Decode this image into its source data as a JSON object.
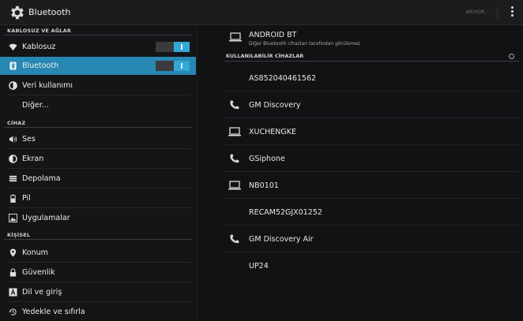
{
  "actionbar": {
    "title": "Bluetooth",
    "status": "ARIYOR...",
    "icon": "settings-gear-icon"
  },
  "sidebar": {
    "sections": [
      {
        "header": "KABLOSUZ VE AĞLAR"
      },
      {
        "header": "CİHAZ"
      },
      {
        "header": "KİŞİSEL"
      }
    ],
    "items": [
      {
        "label": "Kablosuz",
        "icon": "wifi-icon",
        "toggle": "on"
      },
      {
        "label": "Bluetooth",
        "icon": "bluetooth-icon",
        "toggle": "on",
        "selected": true
      },
      {
        "label": "Veri kullanımı",
        "icon": "data-usage-icon"
      },
      {
        "label": "Diğer...",
        "icon": ""
      },
      {
        "label": "Ses",
        "icon": "speaker-icon"
      },
      {
        "label": "Ekran",
        "icon": "display-icon"
      },
      {
        "label": "Depolama",
        "icon": "storage-icon"
      },
      {
        "label": "Pil",
        "icon": "battery-icon"
      },
      {
        "label": "Uygulamalar",
        "icon": "apps-icon"
      },
      {
        "label": "Konum",
        "icon": "location-pin-icon"
      },
      {
        "label": "Güvenlik",
        "icon": "lock-icon"
      },
      {
        "label": "Dil ve giriş",
        "icon": "language-icon"
      },
      {
        "label": "Yedekle ve sıfırla",
        "icon": "backup-icon"
      }
    ]
  },
  "main": {
    "this_device": {
      "name": "ANDROID BT",
      "subtitle": "Diğer Bluetooth cihazları tarafından görülemez",
      "icon": "laptop-icon"
    },
    "available_header": "KULLANILABİLİR CİHAZLAR",
    "devices": [
      {
        "name": "AS852040461562",
        "icon": ""
      },
      {
        "name": "GM Discovery",
        "icon": "phone-icon"
      },
      {
        "name": "XUCHENGKE",
        "icon": "laptop-icon"
      },
      {
        "name": "GSiphone",
        "icon": "phone-icon"
      },
      {
        "name": "NB0101",
        "icon": "laptop-icon"
      },
      {
        "name": "RECAM52GJX01252",
        "icon": ""
      },
      {
        "name": "GM Discovery Air",
        "icon": "phone-icon"
      },
      {
        "name": "UP24",
        "icon": ""
      }
    ]
  },
  "colors": {
    "accent": "#33a7d6",
    "selected_bg": "#2887b3",
    "background": "#111214"
  }
}
